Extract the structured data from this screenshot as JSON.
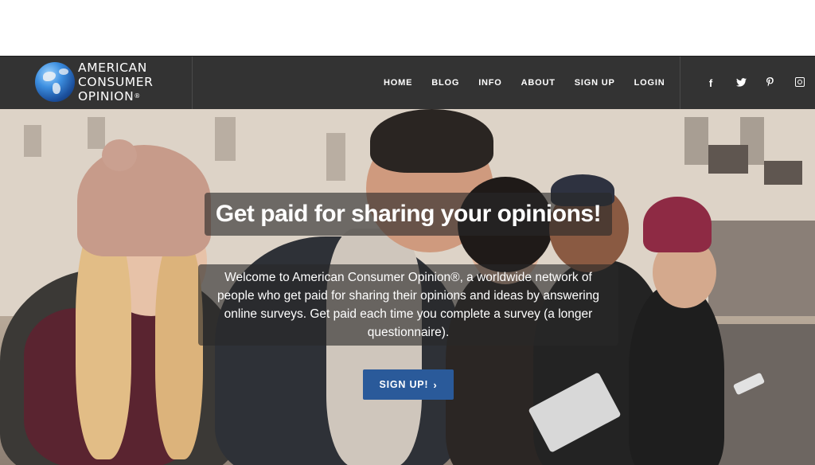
{
  "brand": {
    "line1": "AMERICAN",
    "line2": "CONSUMER",
    "line3": "OPINION",
    "mark": "®",
    "icon": "globe-icon"
  },
  "nav": {
    "items": [
      {
        "label": "HOME"
      },
      {
        "label": "BLOG"
      },
      {
        "label": "INFO"
      },
      {
        "label": "ABOUT"
      },
      {
        "label": "SIGN UP"
      },
      {
        "label": "LOGIN"
      }
    ]
  },
  "social": {
    "facebook": "f",
    "twitter": "🐦",
    "pinterest": "𝓅",
    "icons": [
      "facebook-icon",
      "twitter-icon",
      "pinterest-icon",
      "instagram-icon"
    ]
  },
  "hero": {
    "headline": "Get paid for sharing your opinions!",
    "intro": "Welcome to American Consumer Opinion®, a worldwide network of people who get paid for sharing their opinions and ideas by answering online surveys. Get paid each time you complete a survey (a longer questionnaire).",
    "cta_label": "SIGN UP!",
    "cta_chevron": "›"
  },
  "colors": {
    "header_bg": "#333333",
    "cta_bg": "#2a5a9a",
    "text": "#ffffff"
  }
}
